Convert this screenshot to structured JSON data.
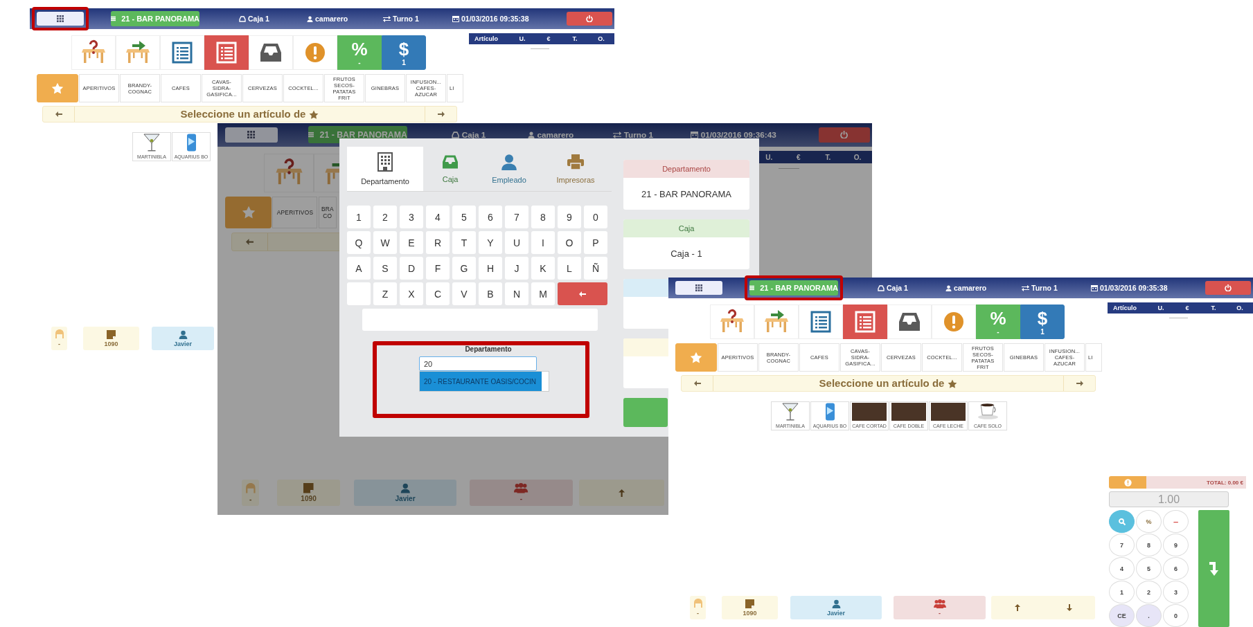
{
  "screens": [
    {
      "dimmed": false,
      "header": {
        "department": "21 - BAR PANORAMA",
        "register": "Caja 1",
        "user": "camarero",
        "shift": "Turno 1",
        "datetime": "01/03/2016 09:35:38",
        "menu_highlighted": true,
        "department_highlighted": false
      },
      "order_columns": [
        "Artículo",
        "U.",
        "€",
        "T.",
        "O."
      ],
      "toolbar": [
        {
          "kind": "table-question"
        },
        {
          "kind": "table-move"
        },
        {
          "kind": "list"
        },
        {
          "kind": "list-alert"
        },
        {
          "kind": "tray"
        },
        {
          "kind": "warning"
        },
        {
          "kind": "discount",
          "symbol": "%",
          "caption": "-"
        },
        {
          "kind": "payment",
          "symbol": "$",
          "caption": "1"
        }
      ],
      "categories": [
        {
          "kind": "favorites",
          "selected": true
        },
        {
          "kind": "category",
          "label": "APERITIVOS",
          "selected": false
        },
        {
          "kind": "category",
          "label": "BRANDY-\nCOGNAC",
          "selected": false
        },
        {
          "kind": "category",
          "label": "CAFES",
          "selected": false
        },
        {
          "kind": "category",
          "label": "CAVAS-\nSIDRA-\nGASIFICA...",
          "selected": false
        },
        {
          "kind": "category",
          "label": "CERVEZAS",
          "selected": false
        },
        {
          "kind": "category",
          "label": "COCKTEL...",
          "selected": false
        },
        {
          "kind": "category",
          "label": "FRUTOS\nSECOS-\nPATATAS\nFRIT",
          "selected": false
        },
        {
          "kind": "category",
          "label": "GINEBRAS",
          "selected": false
        },
        {
          "kind": "category",
          "label": "INFUSION...\nCAFES-\nAZUCAR",
          "selected": false
        },
        {
          "kind": "category",
          "label": "LI",
          "selected": false
        }
      ],
      "selection_bar": {
        "text": "Seleccione un artículo de"
      },
      "products": [
        {
          "kind": "martini",
          "name": "MARTINIBLA"
        },
        {
          "kind": "can",
          "name": "AQUARIUS BO"
        }
      ],
      "bottom": {
        "customer": "-",
        "table": "1090",
        "employee": "Javier"
      }
    },
    {
      "dimmed": true,
      "header": {
        "department": "21 - BAR PANORAMA",
        "register": "Caja 1",
        "user": "camarero",
        "shift": "Turno 1",
        "datetime": "01/03/2016 09:36:43",
        "menu_highlighted": false,
        "department_highlighted": false
      },
      "order_columns": [
        "U.",
        "€",
        "T.",
        "O."
      ],
      "toolbar": [
        {
          "kind": "table-question"
        },
        {
          "kind": "table-move"
        }
      ],
      "categories": [
        {
          "kind": "favorites",
          "selected": true
        },
        {
          "kind": "category",
          "label": "APERITIVOS",
          "selected": false
        },
        {
          "kind": "category",
          "label": "BRA\nCO",
          "selected": false
        }
      ],
      "bottom": {
        "customer": "-",
        "table": "1090",
        "employee": "Javier",
        "guests": "-",
        "pager": [
          {
            "kind": "up"
          }
        ]
      },
      "dialog": {
        "tabs": [
          {
            "kind": "building",
            "label": "Departamento",
            "selected": true
          },
          {
            "kind": "tray",
            "label": "Caja",
            "selected": false
          },
          {
            "kind": "user",
            "label": "Empleado",
            "selected": false
          },
          {
            "kind": "printer",
            "label": "Impresoras",
            "selected": false
          }
        ],
        "keyboard": [
          [
            {
              "label": "1"
            },
            {
              "label": "2"
            },
            {
              "label": "3"
            },
            {
              "label": "4"
            },
            {
              "label": "5"
            },
            {
              "label": "6"
            },
            {
              "label": "7"
            },
            {
              "label": "8"
            },
            {
              "label": "9"
            },
            {
              "label": "0"
            }
          ],
          [
            {
              "label": "Q"
            },
            {
              "label": "W"
            },
            {
              "label": "E"
            },
            {
              "label": "R"
            },
            {
              "label": "T"
            },
            {
              "label": "Y"
            },
            {
              "label": "U"
            },
            {
              "label": "I"
            },
            {
              "label": "O"
            },
            {
              "label": "P"
            }
          ],
          [
            {
              "label": "A"
            },
            {
              "label": "S"
            },
            {
              "label": "D"
            },
            {
              "label": "F"
            },
            {
              "label": "G"
            },
            {
              "label": "H"
            },
            {
              "label": "J"
            },
            {
              "label": "K"
            },
            {
              "label": "L"
            },
            {
              "label": "Ñ"
            }
          ],
          [
            {
              "kind": "blank"
            },
            {
              "label": "Z"
            },
            {
              "label": "X"
            },
            {
              "label": "C"
            },
            {
              "label": "V"
            },
            {
              "label": "B"
            },
            {
              "label": "N"
            },
            {
              "label": "M"
            },
            {
              "kind": "backspace"
            }
          ]
        ],
        "search": {
          "label": "Departamento",
          "value": "20",
          "option": "20 - RESTAURANTE OASIS/COCIN",
          "highlighted": true
        },
        "summary": [
          {
            "kind": "danger",
            "title": "Departamento",
            "value": "21 - BAR PANORAMA"
          },
          {
            "kind": "success",
            "title": "Caja",
            "value": "Caja - 1"
          },
          {
            "kind": "info"
          },
          {
            "kind": "warning"
          }
        ]
      }
    },
    {
      "dimmed": false,
      "header": {
        "department": "21 - BAR PANORAMA",
        "register": "Caja 1",
        "user": "camarero",
        "shift": "Turno 1",
        "datetime": "01/03/2016 09:35:38",
        "menu_highlighted": false,
        "department_highlighted": true
      },
      "order_columns": [
        "Artículo",
        "U.",
        "€",
        "T.",
        "O."
      ],
      "toolbar": [
        {
          "kind": "table-question"
        },
        {
          "kind": "table-move"
        },
        {
          "kind": "list"
        },
        {
          "kind": "list-alert"
        },
        {
          "kind": "tray"
        },
        {
          "kind": "warning"
        },
        {
          "kind": "discount",
          "symbol": "%",
          "caption": "-"
        },
        {
          "kind": "payment",
          "symbol": "$",
          "caption": "1"
        }
      ],
      "categories": [
        {
          "kind": "favorites",
          "selected": true
        },
        {
          "kind": "category",
          "label": "APERITIVOS",
          "selected": false
        },
        {
          "kind": "category",
          "label": "BRANDY-\nCOGNAC",
          "selected": false
        },
        {
          "kind": "category",
          "label": "CAFES",
          "selected": false
        },
        {
          "kind": "category",
          "label": "CAVAS-\nSIDRA-\nGASIFICA...",
          "selected": false
        },
        {
          "kind": "category",
          "label": "CERVEZAS",
          "selected": false
        },
        {
          "kind": "category",
          "label": "COCKTEL...",
          "selected": false
        },
        {
          "kind": "category",
          "label": "FRUTOS\nSECOS-\nPATATAS\nFRIT",
          "selected": false
        },
        {
          "kind": "category",
          "label": "GINEBRAS",
          "selected": false
        },
        {
          "kind": "category",
          "label": "INFUSION...\nCAFES-\nAZUCAR",
          "selected": false
        },
        {
          "kind": "category",
          "label": "LI",
          "selected": false
        }
      ],
      "selection_bar": {
        "text": "Seleccione un artículo de"
      },
      "products": [
        {
          "kind": "martini",
          "name": "MARTINIBLA"
        },
        {
          "kind": "can",
          "name": "AQUARIUS BO"
        },
        {
          "kind": "photo",
          "name": "CAFE CORTAD"
        },
        {
          "kind": "photo",
          "name": "CAFE DOBLE"
        },
        {
          "kind": "photo",
          "name": "CAFE LECHE"
        },
        {
          "kind": "cup",
          "name": "CAFE SOLO"
        }
      ],
      "bottom": {
        "customer": "-",
        "table": "1090",
        "employee": "Javier",
        "guests": "-",
        "pager": [
          {
            "kind": "up"
          },
          {
            "kind": "down"
          }
        ]
      },
      "keypad": {
        "total": "TOTAL: 0.00 €",
        "quantity": "1.00",
        "keys": [
          {
            "kind": "search"
          },
          {
            "kind": "percent",
            "label": "%"
          },
          {
            "kind": "minus",
            "label": "–"
          },
          {
            "kind": "digit",
            "label": "7"
          },
          {
            "kind": "digit",
            "label": "8"
          },
          {
            "kind": "digit",
            "label": "9"
          },
          {
            "kind": "digit",
            "label": "4"
          },
          {
            "kind": "digit",
            "label": "5"
          },
          {
            "kind": "digit",
            "label": "6"
          },
          {
            "kind": "digit",
            "label": "1"
          },
          {
            "kind": "digit",
            "label": "2"
          },
          {
            "kind": "digit",
            "label": "3"
          },
          {
            "kind": "clear",
            "label": "CE"
          },
          {
            "kind": "clear",
            "label": "."
          },
          {
            "kind": "digit",
            "label": "0"
          }
        ]
      }
    }
  ]
}
